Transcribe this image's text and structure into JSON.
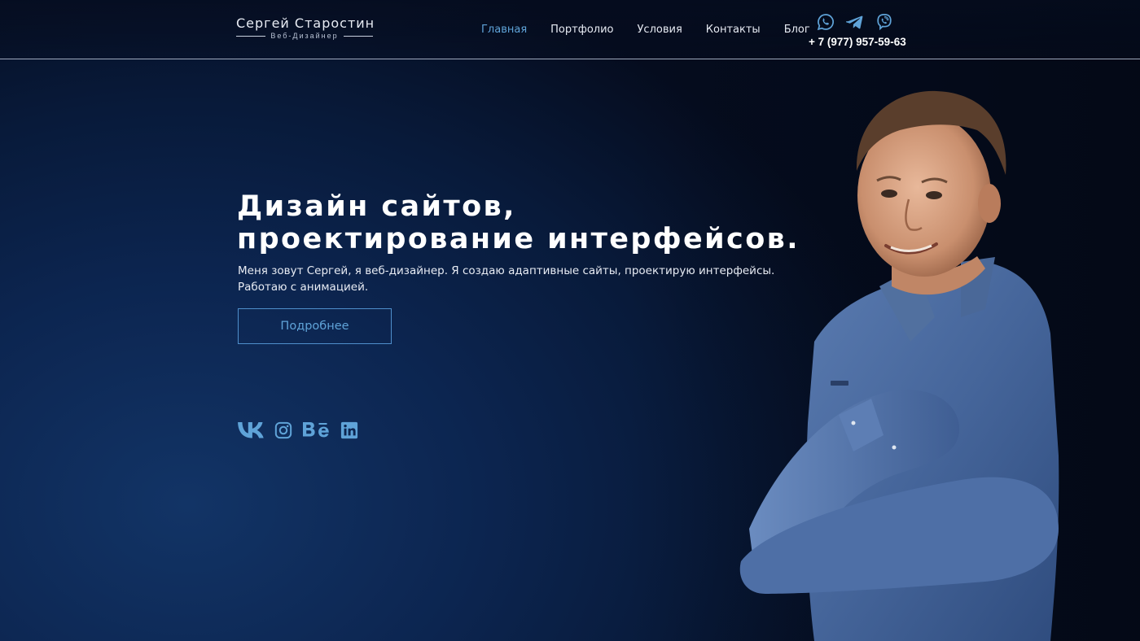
{
  "logo": {
    "name": "Сергей Старостин",
    "subtitle": "Веб-Дизайнер"
  },
  "nav": {
    "items": [
      {
        "label": "Главная",
        "active": true
      },
      {
        "label": "Портфолио",
        "active": false
      },
      {
        "label": "Условия",
        "active": false
      },
      {
        "label": "Контакты",
        "active": false
      },
      {
        "label": "Блог",
        "active": false
      }
    ]
  },
  "contacts": {
    "messengers": [
      "whatsapp-icon",
      "telegram-icon",
      "viber-icon"
    ],
    "phone": "+ 7 (977) 957-59-63"
  },
  "hero": {
    "title_line1": "Дизайн сайтов,",
    "title_line2": "проектирование интерфейсов.",
    "text_line1": "Меня зовут Сергей, я веб-дизайнер. Я создаю адаптивные сайты, проектирую интерфейсы.",
    "text_line2": "Работаю с анимацией.",
    "button_label": "Подробнее"
  },
  "socials": [
    "vk-icon",
    "instagram-icon",
    "behance-icon",
    "linkedin-icon"
  ],
  "colors": {
    "accent": "#5fa3d8",
    "background": "#0c2550",
    "text": "#ffffff"
  }
}
